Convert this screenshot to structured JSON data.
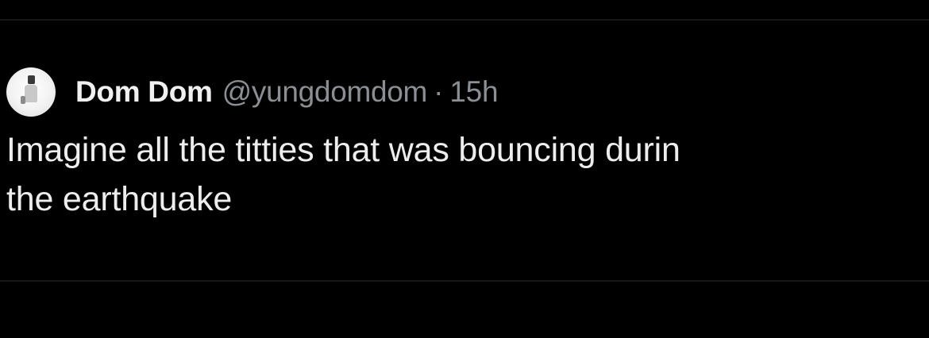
{
  "tweet": {
    "author": {
      "display_name": "Dom Dom",
      "handle": "@yungdomdom",
      "avatar_icon": "profile-avatar"
    },
    "separator": "·",
    "time": "15h",
    "text_lines": [
      "Imagine all the titties that was bouncing durin",
      "the earthquake"
    ]
  },
  "colors": {
    "background": "#000000",
    "primary_text": "#e7e9ea",
    "secondary_text": "#8b8f94",
    "divider": "#16181a"
  }
}
